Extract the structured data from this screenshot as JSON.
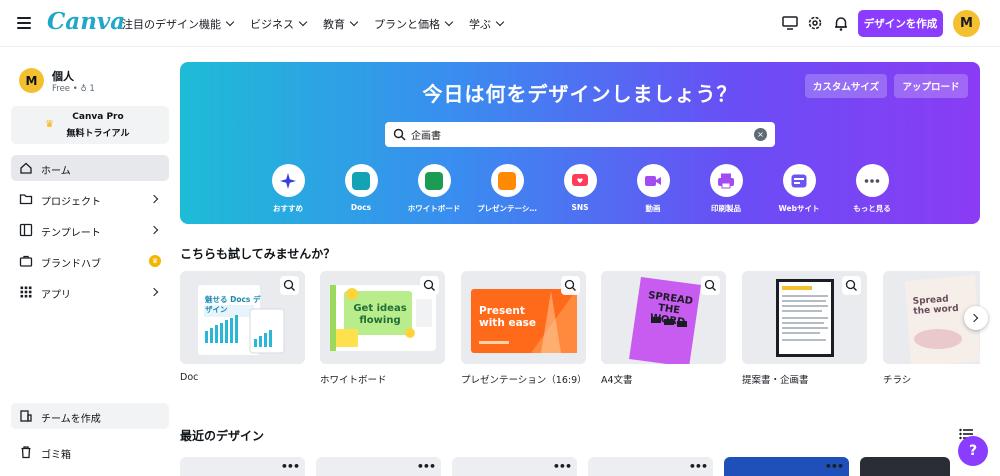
{
  "header": {
    "logo": "Canva",
    "nav": [
      "注目のデザイン機能",
      "ビジネス",
      "教育",
      "プランと価格",
      "学ぶ"
    ],
    "create_label": "デザインを作成",
    "avatar_letter": "M"
  },
  "sidebar": {
    "account_name": "個人",
    "account_plan": "Free • ♁ 1",
    "avatar_letter": "M",
    "trial_line1": "Canva Pro",
    "trial_line2": "無料トライアル",
    "items": [
      {
        "label": "ホーム"
      },
      {
        "label": "プロジェクト"
      },
      {
        "label": "テンプレート"
      },
      {
        "label": "ブランドハブ"
      },
      {
        "label": "アプリ"
      }
    ],
    "team_label": "チームを作成",
    "trash_label": "ゴミ箱"
  },
  "hero": {
    "title": "今日は何をデザインしましょう？",
    "custom_size_label": "カスタムサイズ",
    "upload_label": "アップロード",
    "search_value": "企画書",
    "categories": [
      {
        "label": "おすすめ",
        "color": "#3b3fd8"
      },
      {
        "label": "Docs",
        "color": "#13a3b5"
      },
      {
        "label": "ホワイトボード",
        "color": "#1b9c52"
      },
      {
        "label": "プレゼンテーシ…",
        "color": "#ff8a00"
      },
      {
        "label": "SNS",
        "color": "#ff3d5a"
      },
      {
        "label": "動画",
        "color": "#a24bf2"
      },
      {
        "label": "印刷製品",
        "color": "#a24bf2"
      },
      {
        "label": "Webサイト",
        "color": "#6a55f2"
      },
      {
        "label": "もっと見る",
        "color": "#4a4f5a"
      }
    ]
  },
  "try_section": {
    "title": "こちらも試してみませんか？",
    "cards": [
      {
        "label": "Doc",
        "thumb_text": "魅せる Docs デザイン"
      },
      {
        "label": "ホワイトボード",
        "thumb_text": "Get ideas flowing"
      },
      {
        "label": "プレゼンテーション（16:9）",
        "thumb_text": "Present with ease"
      },
      {
        "label": "A4文書",
        "thumb_text": "SPREAD THE WORD"
      },
      {
        "label": "提案書・企画書",
        "thumb_text": ""
      },
      {
        "label": "チラシ",
        "thumb_text": "Spread the word"
      }
    ]
  },
  "recent_section": {
    "title": "最近のデザイン"
  },
  "help_label": "?"
}
